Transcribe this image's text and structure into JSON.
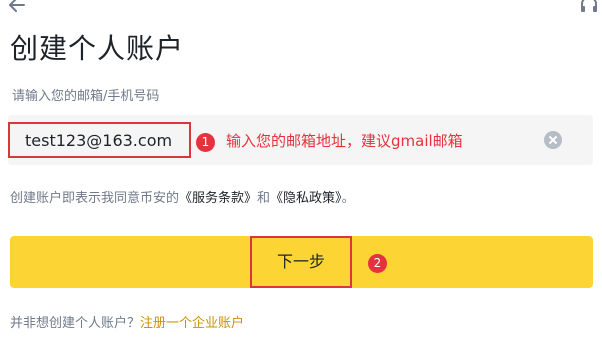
{
  "header": {
    "back_icon": "arrow-left-icon",
    "support_icon": "headset-icon"
  },
  "title": "创建个人账户",
  "email_field": {
    "label": "请输入您的邮箱/手机号码",
    "value": "test123@163.com",
    "clear_icon": "clear-circle-icon"
  },
  "annotations": {
    "step1_number": "1",
    "step1_text": "输入您的邮箱地址，建议gmail邮箱",
    "step2_number": "2"
  },
  "terms": {
    "prefix": "创建账户即表示我同意币安的",
    "terms_of_service": "《服务条款》",
    "and": "和",
    "privacy_policy": "《隐私政策》",
    "suffix": "。"
  },
  "next_button": {
    "label": "下一步"
  },
  "footer": {
    "question": "并非想创建个人账户？",
    "link": "注册一个企业账户"
  },
  "colors": {
    "accent_yellow": "#fcd535",
    "annotation_red": "#e5323e",
    "link_gold": "#c99400"
  }
}
